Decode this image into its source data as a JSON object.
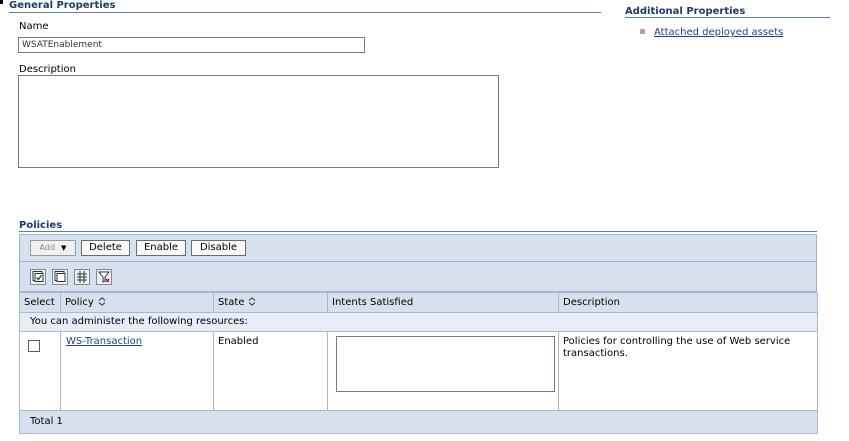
{
  "general": {
    "title": "General Properties",
    "name_label": "Name",
    "name_value": "WSATEnablement",
    "description_label": "Description",
    "description_value": ""
  },
  "additional": {
    "title": "Additional Properties",
    "links": [
      {
        "label": "Attached deployed assets"
      }
    ]
  },
  "policies": {
    "title": "Policies",
    "buttons": {
      "add": "Add",
      "delete": "Delete",
      "enable": "Enable",
      "disable": "Disable"
    },
    "icons": [
      "select-all-icon",
      "deselect-all-icon",
      "show-filter-icon",
      "clear-filter-icon"
    ],
    "columns": {
      "select": "Select",
      "policy": "Policy",
      "state": "State",
      "intents": "Intents Satisfied",
      "description": "Description"
    },
    "resource_note": "You can administer the following resources:",
    "rows": [
      {
        "policy": "WS-Transaction",
        "state": "Enabled",
        "intents": "",
        "description": "Policies for controlling the use of Web service transactions.",
        "selected": false
      }
    ],
    "total": "Total 1"
  },
  "colors": {
    "section_title": "#1d3a6b",
    "link": "#1c3f94",
    "panel_bg": "#d7e1ed",
    "border": "#a6b9cf"
  }
}
